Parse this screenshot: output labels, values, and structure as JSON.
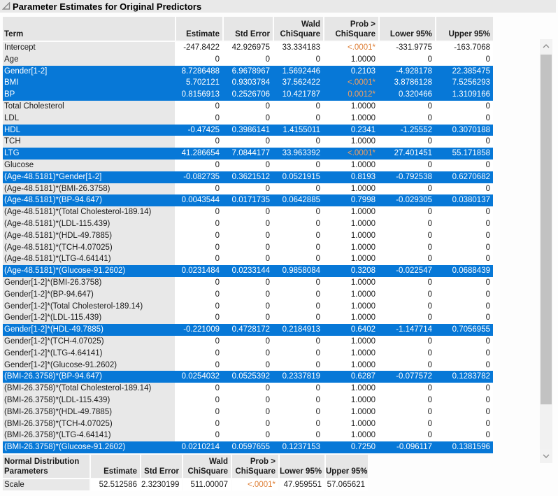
{
  "colors": {
    "selection_blue": "#0778D7",
    "significant_orange": "#DE7E35",
    "significant_orange_on_selection": "#F2A061",
    "header_gray": "#E6E6E6",
    "term_column_gray": "#E8E8E8",
    "title_bar_gray": "#E9E9E9"
  },
  "icons": {
    "disclosure": "disclosure-triangle-icon",
    "scroll_up": "chevron-up-icon",
    "scroll_down": "chevron-down-icon"
  },
  "title": "Parameter Estimates for Original Predictors",
  "main_table": {
    "columns": [
      {
        "l1": "",
        "l2": "Term"
      },
      {
        "l1": "",
        "l2": "Estimate"
      },
      {
        "l1": "",
        "l2": "Std Error"
      },
      {
        "l1": "Wald",
        "l2": "ChiSquare"
      },
      {
        "l1": "Prob >",
        "l2": "ChiSquare"
      },
      {
        "l1": "",
        "l2": "Lower 95%"
      },
      {
        "l1": "",
        "l2": "Upper 95%"
      }
    ],
    "row_format": [
      "term",
      "estimate",
      "std_error",
      "wald_chisquare",
      "prob_chisquare",
      "lower_95",
      "upper_95",
      "selected",
      "significant"
    ],
    "rows": [
      [
        "Intercept",
        "-247.8422",
        "42.926975",
        "33.334183",
        "<.0001*",
        "-331.9775",
        "-163.7068",
        0,
        1
      ],
      [
        "Age",
        "0",
        "0",
        "0",
        "1.0000",
        "0",
        "0",
        0,
        0
      ],
      [
        "Gender[1-2]",
        "8.7286488",
        "6.9678967",
        "1.5692446",
        "0.2103",
        "-4.928178",
        "22.385475",
        1,
        0
      ],
      [
        "BMI",
        "5.702121",
        "0.9303784",
        "37.562422",
        "<.0001*",
        "3.8786128",
        "7.5256293",
        1,
        1
      ],
      [
        "BP",
        "0.8156913",
        "0.2526706",
        "10.421787",
        "0.0012*",
        "0.320466",
        "1.3109166",
        1,
        1
      ],
      [
        "Total Cholesterol",
        "0",
        "0",
        "0",
        "1.0000",
        "0",
        "0",
        0,
        0
      ],
      [
        "LDL",
        "0",
        "0",
        "0",
        "1.0000",
        "0",
        "0",
        0,
        0
      ],
      [
        "HDL",
        "-0.47425",
        "0.3986141",
        "1.4155011",
        "0.2341",
        "-1.25552",
        "0.3070188",
        1,
        0
      ],
      [
        "TCH",
        "0",
        "0",
        "0",
        "1.0000",
        "0",
        "0",
        0,
        0
      ],
      [
        "LTG",
        "41.286654",
        "7.0844177",
        "33.963392",
        "<.0001*",
        "27.401451",
        "55.171858",
        1,
        1
      ],
      [
        "Glucose",
        "0",
        "0",
        "0",
        "1.0000",
        "0",
        "0",
        0,
        0
      ],
      [
        "(Age-48.5181)*Gender[1-2]",
        "-0.082735",
        "0.3621512",
        "0.0521915",
        "0.8193",
        "-0.792538",
        "0.6270682",
        1,
        0
      ],
      [
        "(Age-48.5181)*(BMI-26.3758)",
        "0",
        "0",
        "0",
        "1.0000",
        "0",
        "0",
        0,
        0
      ],
      [
        "(Age-48.5181)*(BP-94.647)",
        "0.0043544",
        "0.0171735",
        "0.0642885",
        "0.7998",
        "-0.029305",
        "0.0380137",
        1,
        0
      ],
      [
        "(Age-48.5181)*(Total Cholesterol-189.14)",
        "0",
        "0",
        "0",
        "1.0000",
        "0",
        "0",
        0,
        0
      ],
      [
        "(Age-48.5181)*(LDL-115.439)",
        "0",
        "0",
        "0",
        "1.0000",
        "0",
        "0",
        0,
        0
      ],
      [
        "(Age-48.5181)*(HDL-49.7885)",
        "0",
        "0",
        "0",
        "1.0000",
        "0",
        "0",
        0,
        0
      ],
      [
        "(Age-48.5181)*(TCH-4.07025)",
        "0",
        "0",
        "0",
        "1.0000",
        "0",
        "0",
        0,
        0
      ],
      [
        "(Age-48.5181)*(LTG-4.64141)",
        "0",
        "0",
        "0",
        "1.0000",
        "0",
        "0",
        0,
        0
      ],
      [
        "(Age-48.5181)*(Glucose-91.2602)",
        "0.0231484",
        "0.0233144",
        "0.9858084",
        "0.3208",
        "-0.022547",
        "0.0688439",
        1,
        0
      ],
      [
        "Gender[1-2]*(BMI-26.3758)",
        "0",
        "0",
        "0",
        "1.0000",
        "0",
        "0",
        0,
        0
      ],
      [
        "Gender[1-2]*(BP-94.647)",
        "0",
        "0",
        "0",
        "1.0000",
        "0",
        "0",
        0,
        0
      ],
      [
        "Gender[1-2]*(Total Cholesterol-189.14)",
        "0",
        "0",
        "0",
        "1.0000",
        "0",
        "0",
        0,
        0
      ],
      [
        "Gender[1-2]*(LDL-115.439)",
        "0",
        "0",
        "0",
        "1.0000",
        "0",
        "0",
        0,
        0
      ],
      [
        "Gender[1-2]*(HDL-49.7885)",
        "-0.221009",
        "0.4728172",
        "0.2184913",
        "0.6402",
        "-1.147714",
        "0.7056955",
        1,
        0
      ],
      [
        "Gender[1-2]*(TCH-4.07025)",
        "0",
        "0",
        "0",
        "1.0000",
        "0",
        "0",
        0,
        0
      ],
      [
        "Gender[1-2]*(LTG-4.64141)",
        "0",
        "0",
        "0",
        "1.0000",
        "0",
        "0",
        0,
        0
      ],
      [
        "Gender[1-2]*(Glucose-91.2602)",
        "0",
        "0",
        "0",
        "1.0000",
        "0",
        "0",
        0,
        0
      ],
      [
        "(BMI-26.3758)*(BP-94.647)",
        "0.0254032",
        "0.0525392",
        "0.2337819",
        "0.6287",
        "-0.077572",
        "0.1283782",
        1,
        0
      ],
      [
        "(BMI-26.3758)*(Total Cholesterol-189.14)",
        "0",
        "0",
        "0",
        "1.0000",
        "0",
        "0",
        0,
        0
      ],
      [
        "(BMI-26.3758)*(LDL-115.439)",
        "0",
        "0",
        "0",
        "1.0000",
        "0",
        "0",
        0,
        0
      ],
      [
        "(BMI-26.3758)*(HDL-49.7885)",
        "0",
        "0",
        "0",
        "1.0000",
        "0",
        "0",
        0,
        0
      ],
      [
        "(BMI-26.3758)*(TCH-4.07025)",
        "0",
        "0",
        "0",
        "1.0000",
        "0",
        "0",
        0,
        0
      ],
      [
        "(BMI-26.3758)*(LTG-4.64141)",
        "0",
        "0",
        "0",
        "1.0000",
        "0",
        "0",
        0,
        0
      ],
      [
        "(BMI-26.3758)*(Glucose-91.2602)",
        "0.0210214",
        "0.0597655",
        "0.1237153",
        "0.7250",
        "-0.096117",
        "0.1381596",
        1,
        0
      ]
    ]
  },
  "bottom_table": {
    "columns": [
      {
        "l1": "Normal Distribution",
        "l2": "Parameters"
      },
      {
        "l1": "",
        "l2": "Estimate"
      },
      {
        "l1": "",
        "l2": "Std Error"
      },
      {
        "l1": "Wald",
        "l2": "ChiSquare"
      },
      {
        "l1": "Prob >",
        "l2": "ChiSquare"
      },
      {
        "l1": "",
        "l2": "Lower 95%"
      },
      {
        "l1": "",
        "l2": "Upper 95%"
      }
    ],
    "row": [
      "Scale",
      "52.512586",
      "2.3230199",
      "511.00007",
      "<.0001*",
      "47.959551",
      "57.065621"
    ],
    "row_significant": 1
  }
}
